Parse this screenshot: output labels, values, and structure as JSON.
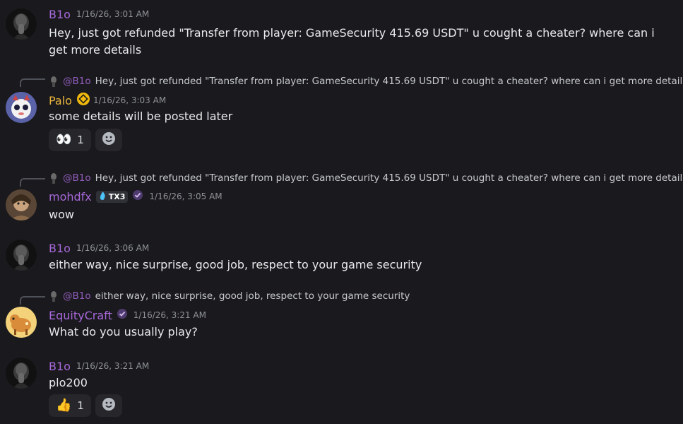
{
  "messages": [
    {
      "author": "B1o",
      "timestamp": "1/16/26, 3:01 AM",
      "text": "Hey, just got refunded \"Transfer from player: GameSecurity    415.69 USDT\" u cought a cheater? where can i get more details"
    },
    {
      "reply": {
        "user": "@B1o",
        "text": "Hey, just got refunded \"Transfer from player: GameSecurity    415.69 USDT\" u cought a cheater? where can i get more details"
      },
      "author": "Palo",
      "timestamp": "1/16/26, 3:03 AM",
      "text": "some details will be posted later",
      "reactions": [
        {
          "emoji": "👀",
          "count": "1"
        }
      ]
    },
    {
      "reply": {
        "user": "@B1o",
        "text": "Hey, just got refunded \"Transfer from player: GameSecurity    415.69 USDT\" u cought a cheater? where can i get more details"
      },
      "author": "mohdfx",
      "server_tag": "TX3",
      "timestamp": "1/16/26, 3:05 AM",
      "text": "wow"
    },
    {
      "author": "B1o",
      "timestamp": "1/16/26, 3:06 AM",
      "text": "either way, nice surprise, good job, respect to your game security"
    },
    {
      "reply": {
        "user": "@B1o",
        "text": "either way, nice surprise, good job, respect to your game security"
      },
      "author": "EquityCraft",
      "timestamp": "1/16/26, 3:21 AM",
      "text": "What do you usually play?"
    },
    {
      "author": "B1o",
      "timestamp": "1/16/26, 3:21 AM",
      "text": "plo200",
      "reactions": [
        {
          "emoji": "👍",
          "count": "1"
        }
      ]
    }
  ],
  "icons": {
    "add_reaction": "smiley-icon",
    "palo_badge": "coin-badge-icon",
    "verified": "verified-check-icon"
  },
  "colors": {
    "background": "#1a1a1e",
    "username_purple": "#a768d9",
    "username_gold": "#e8b33c",
    "timestamp": "#8e9297",
    "reaction_bg": "#26262b"
  }
}
